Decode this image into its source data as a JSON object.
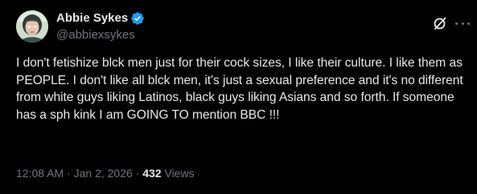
{
  "author": {
    "display_name": "Abbie Sykes",
    "handle": "@abbiexsykes",
    "verified": true,
    "verified_color": "#1d9bf0"
  },
  "icons": {
    "verified": "verified-badge-icon",
    "grok": "grok-icon",
    "more": "more-options-icon"
  },
  "post": {
    "text": "I don't fetishize blck men just for their cock sizes, I like their culture. I like them as PEOPLE. I don't like all blck men, it's just a sexual preference and it's no different from white guys liking Latinos, black guys liking Asians and so forth. If someone has a sph kink I am GOING TO mention BBC !!!"
  },
  "meta": {
    "time": "12:08 AM",
    "separator": " · ",
    "date": "Jan 2, 2026",
    "views_count": "432",
    "views_label": " Views"
  },
  "colors": {
    "background": "#000000",
    "text_primary": "#e7e9ea",
    "text_secondary": "#71767b"
  }
}
